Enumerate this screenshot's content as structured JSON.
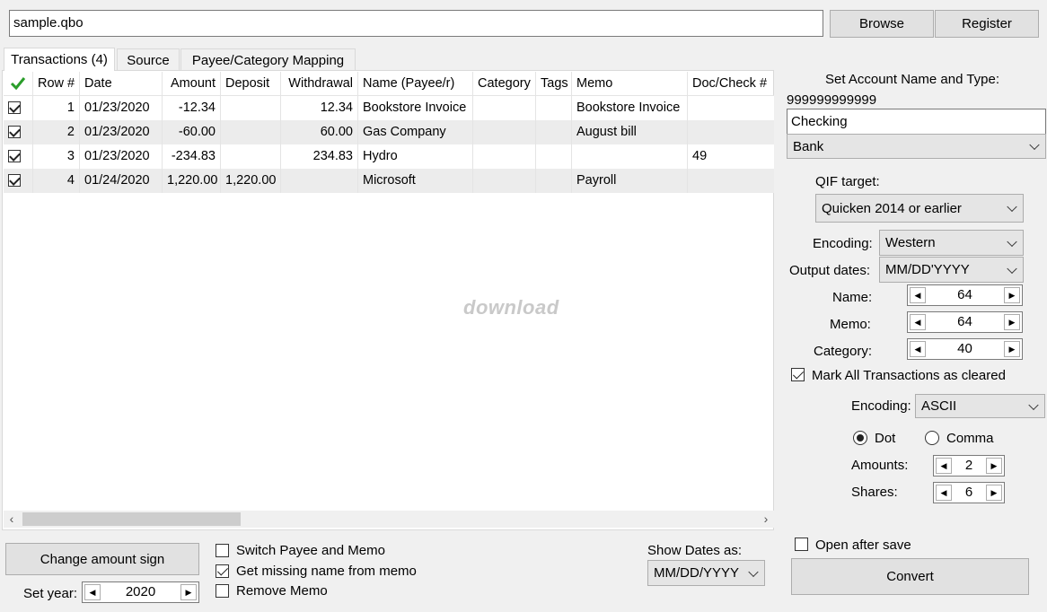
{
  "file": {
    "value": "sample.qbo"
  },
  "buttons": {
    "browse": "Browse",
    "register": "Register",
    "change_sign": "Change amount sign",
    "convert": "Convert"
  },
  "tabs": [
    {
      "label": "Transactions (4)"
    },
    {
      "label": "Source"
    },
    {
      "label": "Payee/Category Mapping"
    }
  ],
  "grid": {
    "columns": [
      "Row #",
      "Date",
      "Amount",
      "Deposit",
      "Withdrawal",
      "Name (Payee/r)",
      "Category",
      "Tags",
      "Memo",
      "Doc/Check #"
    ],
    "rows": [
      {
        "checked": true,
        "row": "1",
        "date": "01/23/2020",
        "amount": "-12.34",
        "deposit": "",
        "withdrawal": "12.34",
        "name": "Bookstore Invoice",
        "category": "",
        "tags": "",
        "memo": "Bookstore Invoice",
        "doc": ""
      },
      {
        "checked": true,
        "row": "2",
        "date": "01/23/2020",
        "amount": "-60.00",
        "deposit": "",
        "withdrawal": "60.00",
        "name": "Gas Company",
        "category": "",
        "tags": "",
        "memo": "August bill",
        "doc": ""
      },
      {
        "checked": true,
        "row": "3",
        "date": "01/23/2020",
        "amount": "-234.83",
        "deposit": "",
        "withdrawal": "234.83",
        "name": "Hydro",
        "category": "",
        "tags": "",
        "memo": "",
        "doc": "49"
      },
      {
        "checked": true,
        "row": "4",
        "date": "01/24/2020",
        "amount": "1,220.00",
        "deposit": "1,220.00",
        "withdrawal": "",
        "name": "Microsoft",
        "category": "",
        "tags": "",
        "memo": "Payroll",
        "doc": ""
      }
    ]
  },
  "watermark": "download",
  "bottom": {
    "set_year_label": "Set year:",
    "year": "2020",
    "options": {
      "switch": "Switch Payee and Memo",
      "missing": "Get missing name from memo",
      "remove": "Remove Memo"
    },
    "options_checked": {
      "switch": false,
      "missing": true,
      "remove": false
    },
    "show_dates_label": "Show Dates as:",
    "show_dates_value": "MM/DD/YYYY"
  },
  "account": {
    "heading": "Set Account Name and Type:",
    "number": "999999999999",
    "name": "Checking",
    "type": "Bank"
  },
  "qif": {
    "target_label": "QIF target:",
    "target_value": "Quicken 2014 or earlier",
    "encoding_label": "Encoding:",
    "encoding_value": "Western",
    "output_dates_label": "Output dates:",
    "output_dates_value": "MM/DD'YYYY",
    "name_label": "Name:",
    "name_value": "64",
    "memo_label": "Memo:",
    "memo_value": "64",
    "category_label": "Category:",
    "category_value": "40",
    "mark_cleared": "Mark All Transactions as cleared",
    "mark_cleared_checked": true,
    "encoding2_label": "Encoding:",
    "encoding2_value": "ASCII",
    "dot": "Dot",
    "comma": "Comma",
    "decimal_selected": "Dot",
    "amounts_label": "Amounts:",
    "amounts_value": "2",
    "shares_label": "Shares:",
    "shares_value": "6",
    "open_after_save": "Open after save",
    "open_after_save_checked": false
  },
  "colors": {
    "accent_check": "#2a9d2a",
    "row_alt": "#ececec"
  }
}
